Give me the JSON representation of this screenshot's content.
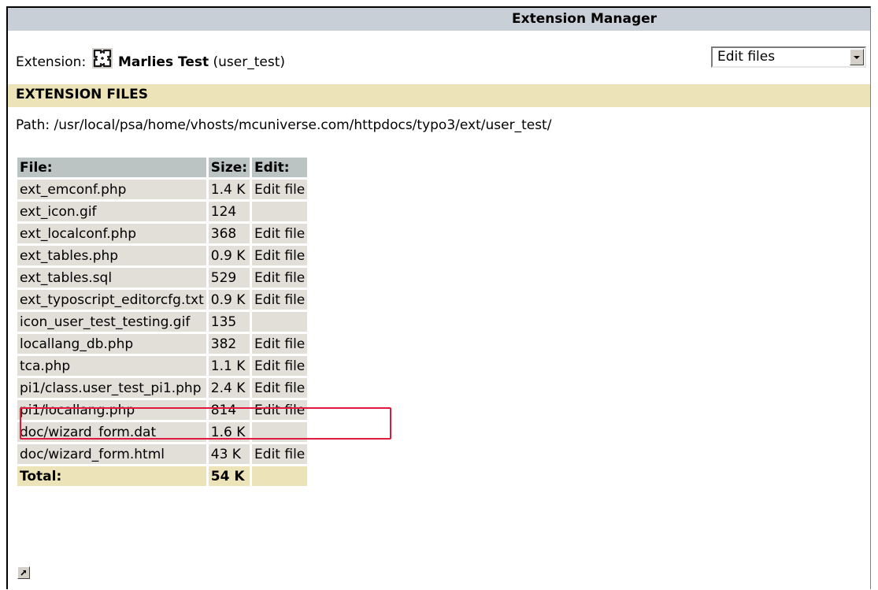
{
  "header": {
    "title": "Extension Manager"
  },
  "extension": {
    "label": "Extension:",
    "name": "Marlies Test",
    "key": "(user_test)",
    "icon": "puzzle-piece-icon"
  },
  "mode_select": {
    "value": "Edit files"
  },
  "section": {
    "title": "EXTENSION FILES",
    "path": "Path: /usr/local/psa/home/vhosts/mcuniverse.com/httpdocs/typo3/ext/user_test/"
  },
  "files_table": {
    "columns": [
      "File:",
      "Size:",
      "Edit:"
    ],
    "rows": [
      {
        "file": "ext_emconf.php",
        "size": "1.4 K",
        "edit": "Edit file"
      },
      {
        "file": "ext_icon.gif",
        "size": "124",
        "edit": ""
      },
      {
        "file": "ext_localconf.php",
        "size": "368",
        "edit": "Edit file"
      },
      {
        "file": "ext_tables.php",
        "size": "0.9 K",
        "edit": "Edit file"
      },
      {
        "file": "ext_tables.sql",
        "size": "529",
        "edit": "Edit file"
      },
      {
        "file": "ext_typoscript_editorcfg.txt",
        "size": "0.9 K",
        "edit": "Edit file"
      },
      {
        "file": "icon_user_test_testing.gif",
        "size": "135",
        "edit": ""
      },
      {
        "file": "locallang_db.php",
        "size": "382",
        "edit": "Edit file"
      },
      {
        "file": "tca.php",
        "size": "1.1 K",
        "edit": "Edit file"
      },
      {
        "file": "pi1/class.user_test_pi1.php",
        "size": "2.4 K",
        "edit": "Edit file"
      },
      {
        "file": "pi1/locallang.php",
        "size": "814",
        "edit": "Edit file"
      },
      {
        "file": "doc/wizard_form.dat",
        "size": "1.6 K",
        "edit": ""
      },
      {
        "file": "doc/wizard_form.html",
        "size": "43 K",
        "edit": "Edit file"
      }
    ],
    "total_label": "Total:",
    "total_size": "54 K"
  },
  "colors": {
    "title_bar": "#c8cfd7",
    "section_bar": "#ede3b9",
    "header_cell": "#bcc4c3",
    "row_cell": "#e2dfd9",
    "highlight": "#e0193e"
  },
  "footer": {
    "icon": "open-new-window-icon"
  }
}
